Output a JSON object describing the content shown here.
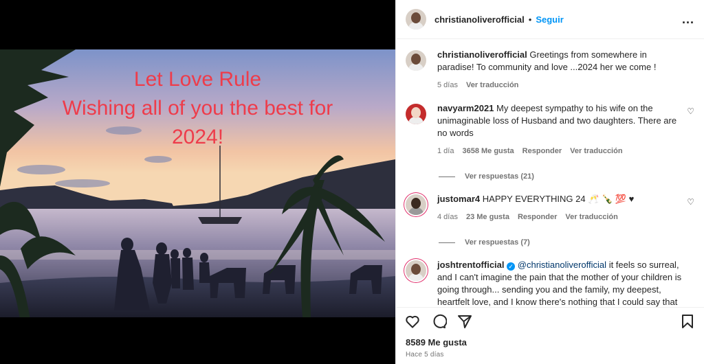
{
  "post": {
    "overlay_lines": [
      "Let Love Rule",
      "Wishing all of you the best for",
      "2024!"
    ]
  },
  "header": {
    "username": "christianoliverofficial",
    "separator": "•",
    "follow_label": "Seguir",
    "more_label": "..."
  },
  "caption": {
    "username": "christianoliverofficial",
    "text": "Greetings from somewhere in paradise! To community and love ...2024 her we come !",
    "time": "5 días",
    "translate": "Ver traducción"
  },
  "comments": [
    {
      "username": "navyarm2021",
      "text": "My deepest sympathy to his wife on the unimaginable loss of Husband and two daughters. There are no words",
      "time": "1 día",
      "likes": "3658 Me gusta",
      "reply": "Responder",
      "translate": "Ver traducción",
      "replies": "Ver respuestas (21)"
    },
    {
      "username": "justomar4",
      "text": "HAPPY EVERYTHING 24 🥂 🍾 💯 ♥",
      "time": "4 días",
      "likes": "23 Me gusta",
      "reply": "Responder",
      "translate": "Ver traducción",
      "replies": "Ver respuestas (7)"
    },
    {
      "username": "joshtrentofficial",
      "mention": "@christianoliverofficial",
      "text": "it feels so surreal, and I can't imagine the pain that the mother of your children is going through... sending you and the family, my deepest, heartfelt love, and I know there's nothing that I could say that would assuage the bereavement of those who love you"
    }
  ],
  "footer": {
    "likes": "8589 Me gusta",
    "ago": "Hace 5 días"
  },
  "icons": {
    "heart": "heart-icon",
    "comment": "comment-icon",
    "share": "share-icon",
    "bookmark": "bookmark-icon"
  },
  "colors": {
    "follow": "#0095f6",
    "overlay_text": "#ee3c4a"
  }
}
